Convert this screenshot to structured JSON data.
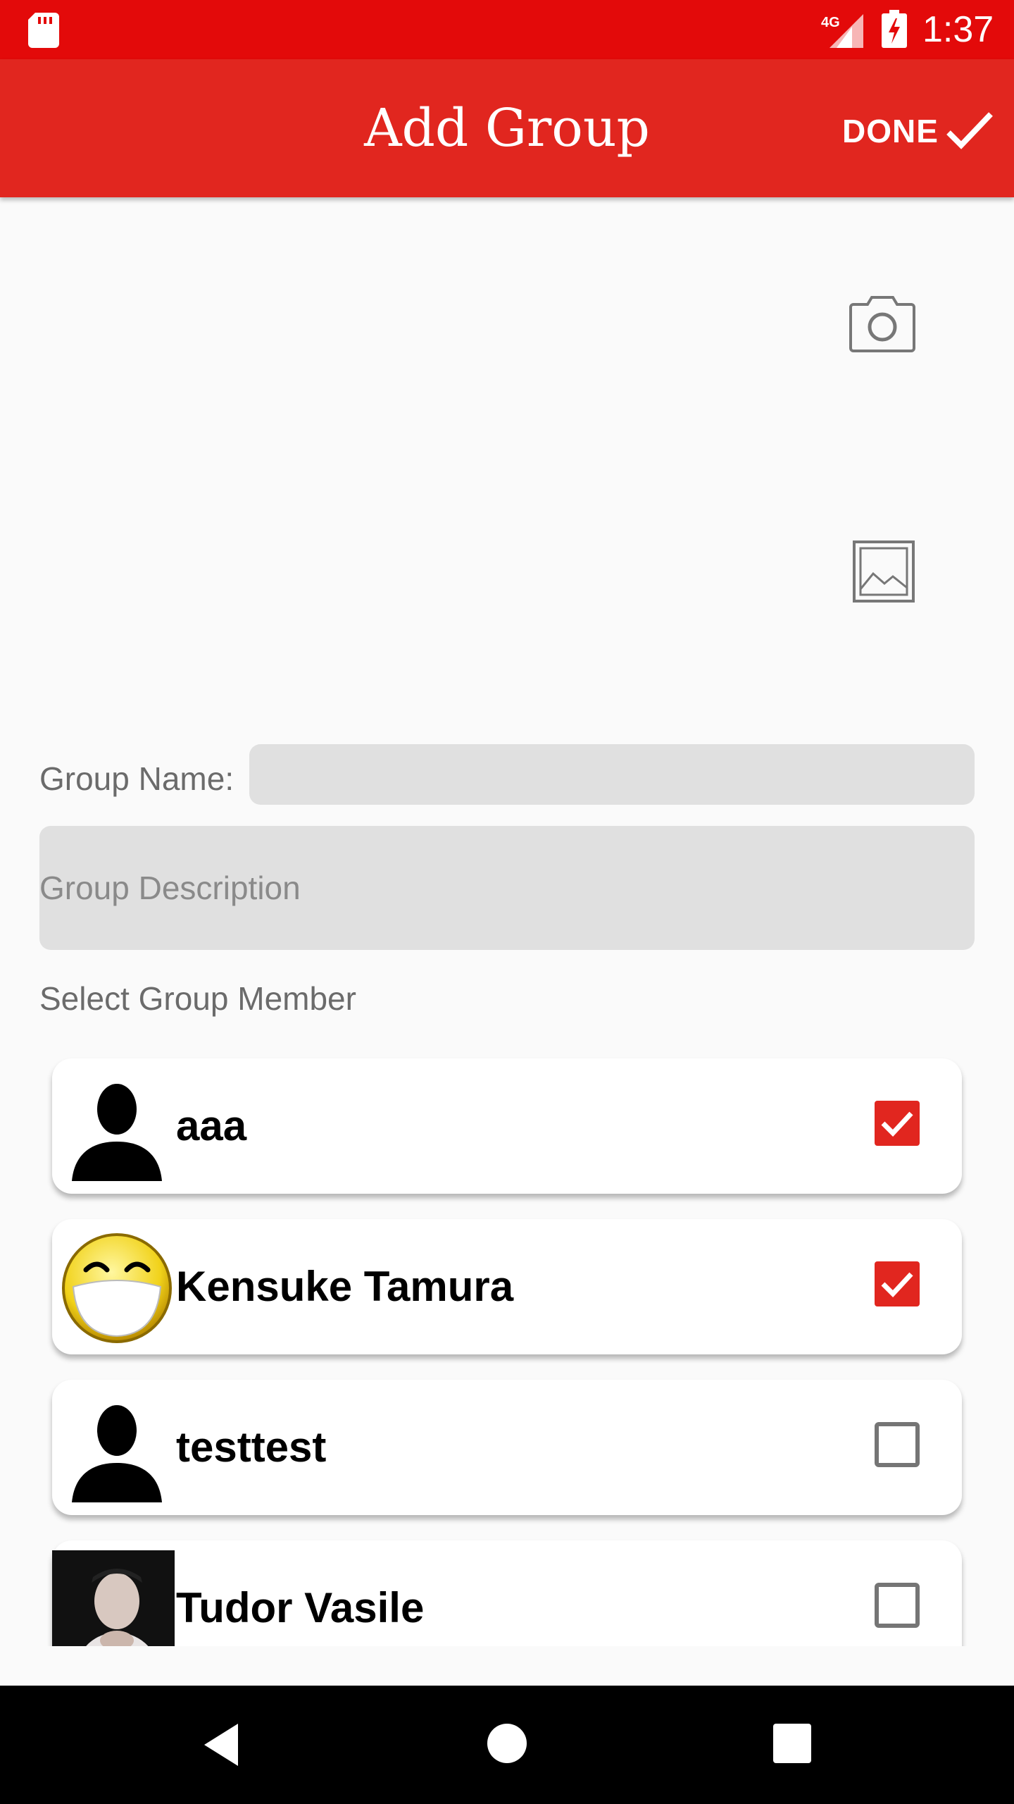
{
  "status_bar": {
    "time": "1:37",
    "network": "4G",
    "icons": [
      "sd-card-icon",
      "signal-icon",
      "battery-charging-icon"
    ]
  },
  "app_bar": {
    "title": "Add Group",
    "done_label": "DONE",
    "done_icon": "checkmark-icon",
    "background": "#e1261f"
  },
  "media_actions": {
    "camera_icon": "camera-icon",
    "gallery_icon": "gallery-icon"
  },
  "form": {
    "group_name_label": "Group Name:",
    "group_name_value": "",
    "group_description_placeholder": "Group Description",
    "group_description_value": "",
    "select_member_label": "Select Group Member"
  },
  "members": [
    {
      "name": "aaa",
      "avatar": "default-silhouette",
      "checked": true
    },
    {
      "name": "Kensuke Tamura",
      "avatar": "smiley-face",
      "checked": true
    },
    {
      "name": "testtest",
      "avatar": "default-silhouette",
      "checked": false
    },
    {
      "name": "Tudor Vasile",
      "avatar": "photo",
      "checked": false
    }
  ],
  "colors": {
    "status_bar": "#e30a0a",
    "accent": "#e1261f",
    "checkbox_checked": "#e1261f"
  },
  "nav_bar": {
    "icons": [
      "back-icon",
      "home-icon",
      "recents-icon"
    ]
  }
}
